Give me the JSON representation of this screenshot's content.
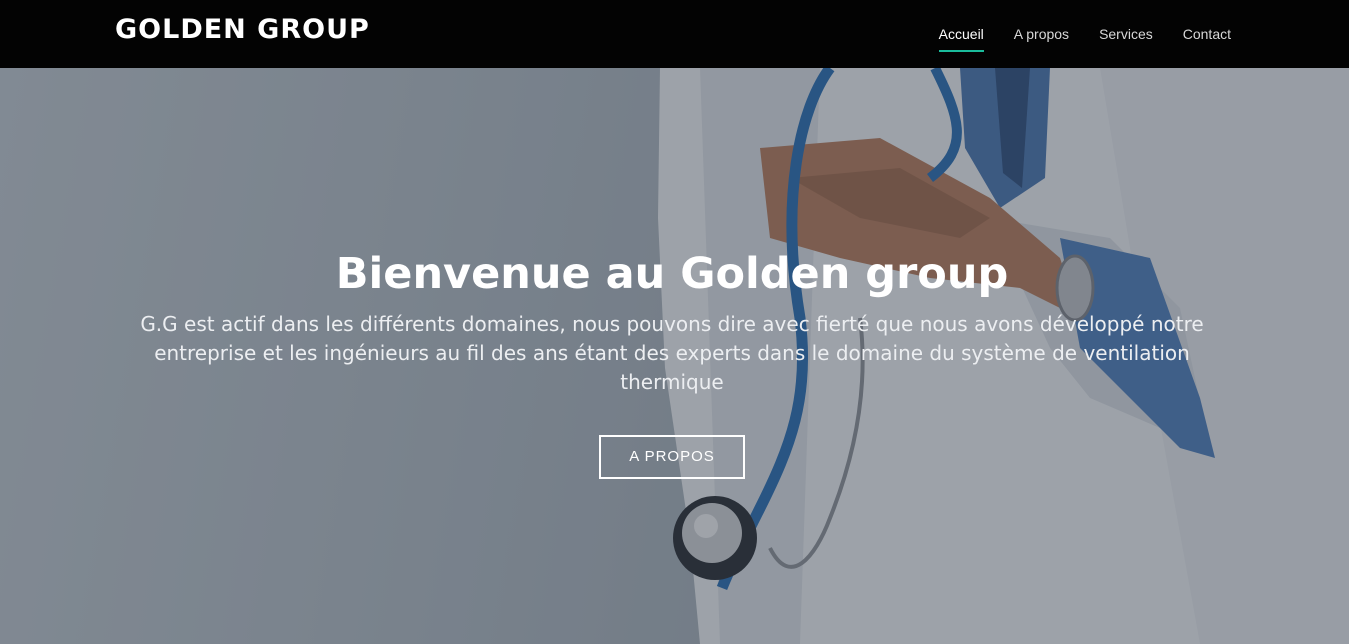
{
  "navbar": {
    "brand": "GOLDEN GROUP",
    "links": [
      {
        "label": "Accueil",
        "active": true
      },
      {
        "label": "A propos",
        "active": false
      },
      {
        "label": "Services",
        "active": false
      },
      {
        "label": "Contact",
        "active": false
      }
    ]
  },
  "hero": {
    "title": "Bienvenue au Golden group",
    "text": "G.G est actif dans les différents domaines, nous pouvons dire avec fierté que nous avons développé notre entreprise et les ingénieurs au fil des ans étant des experts dans le domaine du système de ventilation thermique",
    "button_label": "A PROPOS"
  },
  "colors": {
    "navbar_bg": "#030303",
    "active_underline": "#1abc9c"
  }
}
